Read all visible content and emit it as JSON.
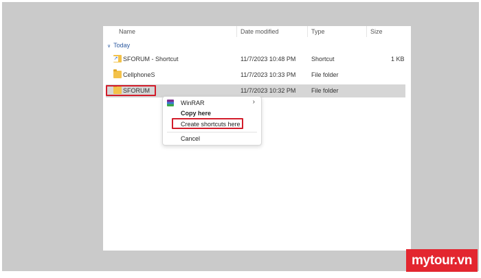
{
  "columns": {
    "name": "Name",
    "date": "Date modified",
    "type": "Type",
    "size": "Size"
  },
  "group_label": "Today",
  "files": [
    {
      "name": "SFORUM - Shortcut",
      "date": "11/7/2023 10:48 PM",
      "type": "Shortcut",
      "size": "1 KB",
      "icon": "shortcut-icon"
    },
    {
      "name": "CellphoneS",
      "date": "11/7/2023 10:33 PM",
      "type": "File folder",
      "size": "",
      "icon": "folder-icon"
    },
    {
      "name": "SFORUM",
      "date": "11/7/2023 10:32 PM",
      "type": "File folder",
      "size": "",
      "icon": "folder-icon",
      "selected": true
    }
  ],
  "context_menu": {
    "winrar": "WinRAR",
    "copy_here": "Copy here",
    "create_shortcuts": "Create shortcuts here",
    "cancel": "Cancel"
  },
  "brand": "mytour.vn",
  "colors": {
    "highlight": "#d21c2a",
    "brand": "#e3262f",
    "selection": "#d6d6d6"
  }
}
